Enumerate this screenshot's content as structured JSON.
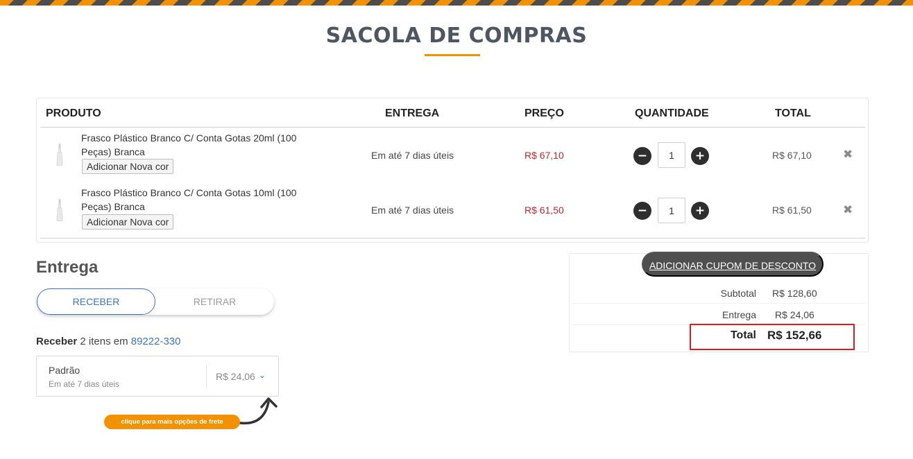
{
  "page": {
    "title": "SACOLA DE COMPRAS"
  },
  "cart": {
    "headers": {
      "product": "PRODUTO",
      "delivery": "ENTREGA",
      "price": "PREÇO",
      "quantity": "QUANTIDADE",
      "total": "TOTAL"
    },
    "items": [
      {
        "name": "Frasco Plástico Branco C/ Conta Gotas 20ml (100 Peças) Branca",
        "add_color_label": "Adicionar Nova cor",
        "delivery": "Em até 7 dias úteis",
        "price": "R$ 67,10",
        "quantity": "1",
        "total": "R$ 67,10"
      },
      {
        "name": "Frasco Plástico Branco C/ Conta Gotas 10ml (100 Peças) Branca",
        "add_color_label": "Adicionar Nova cor",
        "delivery": "Em até 7 dias úteis",
        "price": "R$ 61,50",
        "quantity": "1",
        "total": "R$ 61,50"
      }
    ],
    "qty_minus": "−",
    "qty_plus": "+",
    "remove_glyph": "✖"
  },
  "delivery": {
    "title": "Entrega",
    "tab_receive": "RECEBER",
    "tab_pickup": "RETIRAR",
    "receive_label": "Receber",
    "items_text": "2 itens em",
    "zip": "89222-330",
    "option": {
      "name": "Padrão",
      "time": "Em até 7 dias úteis",
      "price": "R$ 24,06",
      "chevron": "⌄"
    },
    "hint": "clique para mais opções de frete"
  },
  "summary": {
    "coupon_button": "ADICIONAR CUPOM DE DESCONTO",
    "subtotal_label": "Subtotal",
    "subtotal_value": "R$ 128,60",
    "delivery_label": "Entrega",
    "delivery_value": "R$ 24,06",
    "total_label": "Total",
    "total_value": "R$ 152,66"
  },
  "colors": {
    "accent_orange": "#f39200",
    "title_gray": "#4e5661",
    "price_red": "#c0272d",
    "link_blue": "#3c74c2",
    "highlight_red": "#e0191f"
  }
}
